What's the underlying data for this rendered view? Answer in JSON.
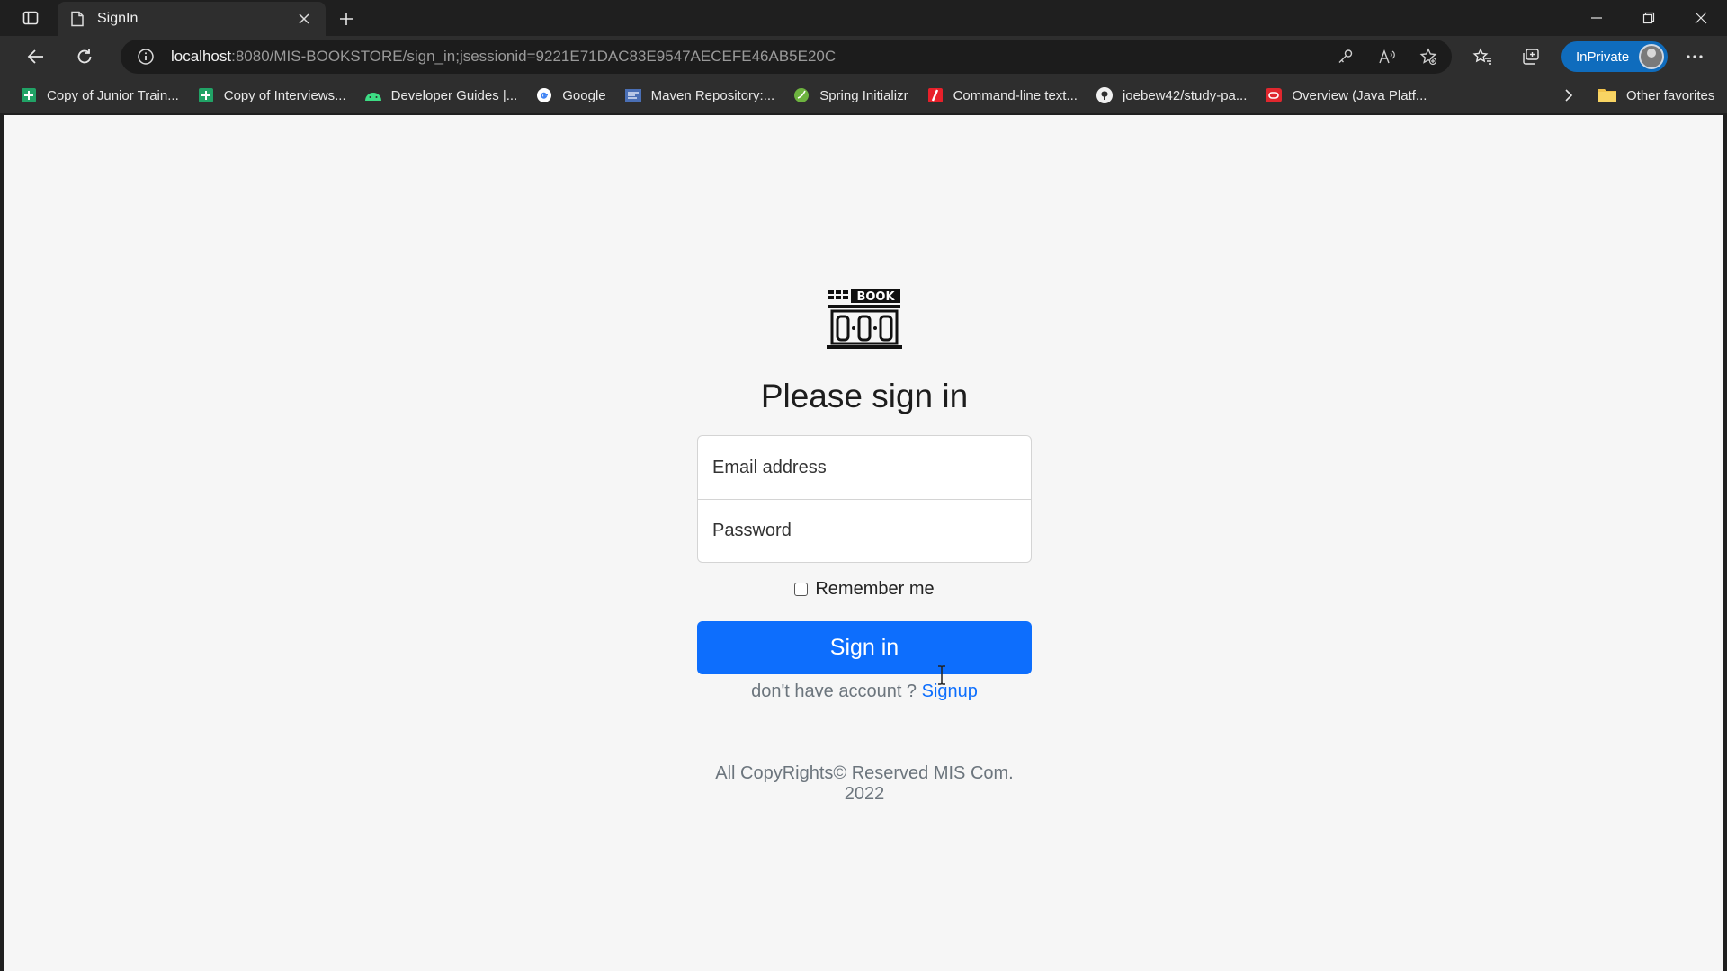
{
  "browser": {
    "tab": {
      "title": "SignIn"
    },
    "address": {
      "host": "localhost",
      "path": ":8080/MIS-BOOKSTORE/sign_in;jsessionid=9221E71DAC83E9547AECEFE46AB5E20C"
    },
    "profile_label": "InPrivate",
    "favorites": [
      {
        "label": "Copy of Junior Train...",
        "icon": "sheets-icon"
      },
      {
        "label": "Copy of Interviews...",
        "icon": "sheets-icon"
      },
      {
        "label": "Developer Guides |...",
        "icon": "android-icon"
      },
      {
        "label": "Google",
        "icon": "google-icon"
      },
      {
        "label": "Maven Repository:...",
        "icon": "maven-icon"
      },
      {
        "label": "Spring Initializr",
        "icon": "spring-icon"
      },
      {
        "label": "Command-line text...",
        "icon": "command-icon"
      },
      {
        "label": "joebew42/study-pa...",
        "icon": "github-icon"
      },
      {
        "label": "Overview (Java Platf...",
        "icon": "oracle-icon"
      }
    ],
    "other_favorites": "Other favorites"
  },
  "page": {
    "logo_text": "BOOK",
    "heading": "Please sign in",
    "email_placeholder": "Email address",
    "password_placeholder": "Password",
    "remember_label": "Remember me",
    "signin_label": "Sign in",
    "signup_prompt": "don't have account ? ",
    "signup_link": "Signup",
    "footer": "All CopyRights© Reserved MIS Com. 2022"
  },
  "colors": {
    "primary": "#0d6efd",
    "muted": "#6c757d",
    "page_bg": "#f6f6f6",
    "chrome_bg": "#2e2e2e"
  }
}
